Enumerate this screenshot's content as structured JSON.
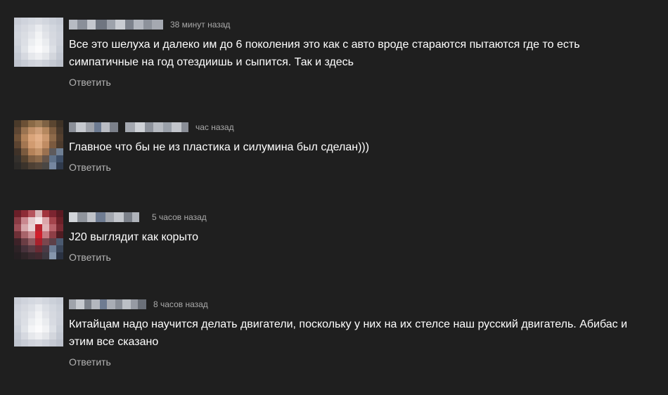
{
  "comments": [
    {
      "time": "38 минут назад",
      "text": "Все это шелуха и далеко им до 6 поколения это как с авто вроде стараются пытаются где то есть симпатичные на год отездиишь и сыпится. Так и здесь",
      "reply_label": "Ответить"
    },
    {
      "time": "час назад",
      "text": "Главное что бы не из пластика и силумина был сделан)))",
      "reply_label": "Ответить"
    },
    {
      "time": "5 часов назад",
      "text": "J20 выглядит как корыто",
      "reply_label": "Ответить"
    },
    {
      "time": "8 часов назад",
      "text": "Китайцам надо научится делать двигатели, поскольку у них на их стелсе наш русский двигатель. Абибас и этим все сказано",
      "reply_label": "Ответить"
    }
  ]
}
